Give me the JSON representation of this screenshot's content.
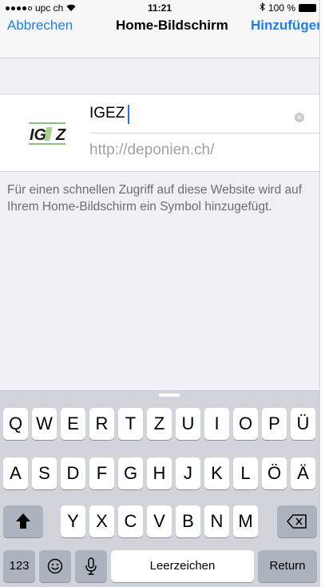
{
  "status_bar": {
    "carrier": "upc ch",
    "time": "11:21",
    "battery": "100 %",
    "signal_icon": "signal-dots-icon",
    "wifi_icon": "wifi-icon",
    "bluetooth_icon": "bluetooth-icon",
    "battery_icon": "battery-icon"
  },
  "nav": {
    "cancel": "Abbrechen",
    "title": "Home-Bildschirm",
    "add": "Hinzufügen"
  },
  "bookmark": {
    "logo_text": "IGEZ",
    "title_value": "IGEZ",
    "url": "http://deponien.ch/",
    "clear_icon": "clear-icon"
  },
  "description": "Für einen schnellen Zugriff auf diese Website wird auf Ihrem Home-Bildschirm ein Symbol hinzugefügt.",
  "keyboard": {
    "row1": [
      "Q",
      "W",
      "E",
      "R",
      "T",
      "Z",
      "U",
      "I",
      "O",
      "P",
      "Ü"
    ],
    "row2": [
      "A",
      "S",
      "D",
      "F",
      "G",
      "H",
      "J",
      "K",
      "L",
      "Ö",
      "Ä"
    ],
    "row3": [
      "Y",
      "X",
      "C",
      "V",
      "B",
      "N",
      "M"
    ],
    "numbers": "123",
    "space": "Leerzeichen",
    "return": "Return",
    "shift_icon": "shift-icon",
    "delete_icon": "delete-icon",
    "emoji_icon": "emoji-icon",
    "mic_icon": "microphone-icon"
  },
  "colors": {
    "accent": "#1a7ef7",
    "keyboard_bg": "#d1d4da",
    "background": "#efeff4"
  }
}
